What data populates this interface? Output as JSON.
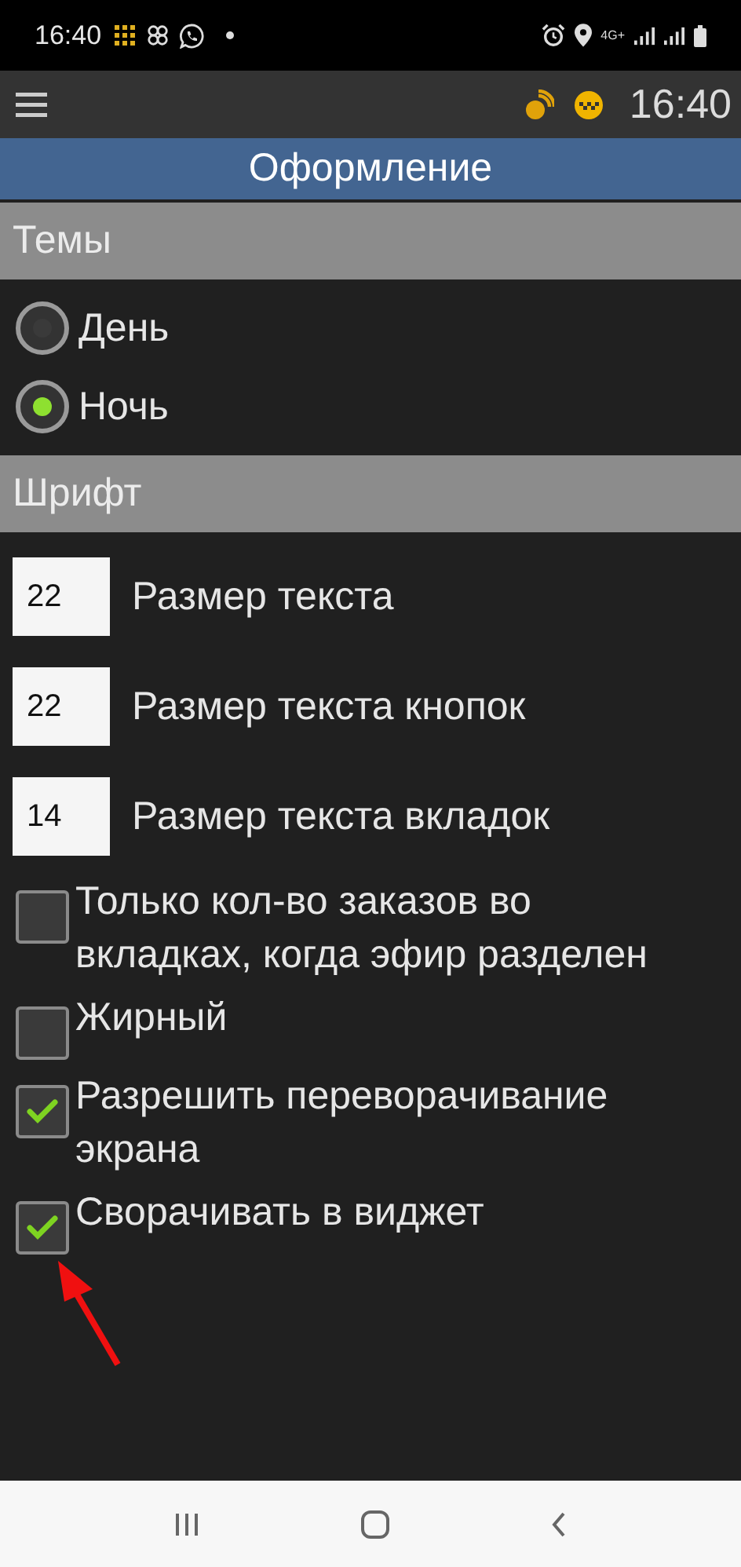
{
  "status_bar": {
    "time": "16:40",
    "network": "4G+"
  },
  "app_bar": {
    "clock": "16:40"
  },
  "title": "Оформление",
  "sections": [
    {
      "title": "Темы",
      "items": [
        {
          "kind": "radio",
          "label": "День",
          "selected": false
        },
        {
          "kind": "radio",
          "label": "Ночь",
          "selected": true
        }
      ]
    },
    {
      "title": "Шрифт",
      "items": [
        {
          "kind": "number",
          "value": "22",
          "label": "Размер текста"
        },
        {
          "kind": "number",
          "value": "22",
          "label": "Размер текста кнопок"
        },
        {
          "kind": "number",
          "value": "14",
          "label": "Размер текста вкладок"
        },
        {
          "kind": "checkbox",
          "label": "Только кол-во заказов во вкладках, когда эфир разделен",
          "checked": false
        },
        {
          "kind": "checkbox",
          "label": "Жирный",
          "checked": false
        },
        {
          "kind": "checkbox",
          "label": "Разрешить переворачивание экрана",
          "checked": true
        },
        {
          "kind": "checkbox",
          "label": "Сворачивать в виджет",
          "checked": true
        }
      ]
    }
  ]
}
